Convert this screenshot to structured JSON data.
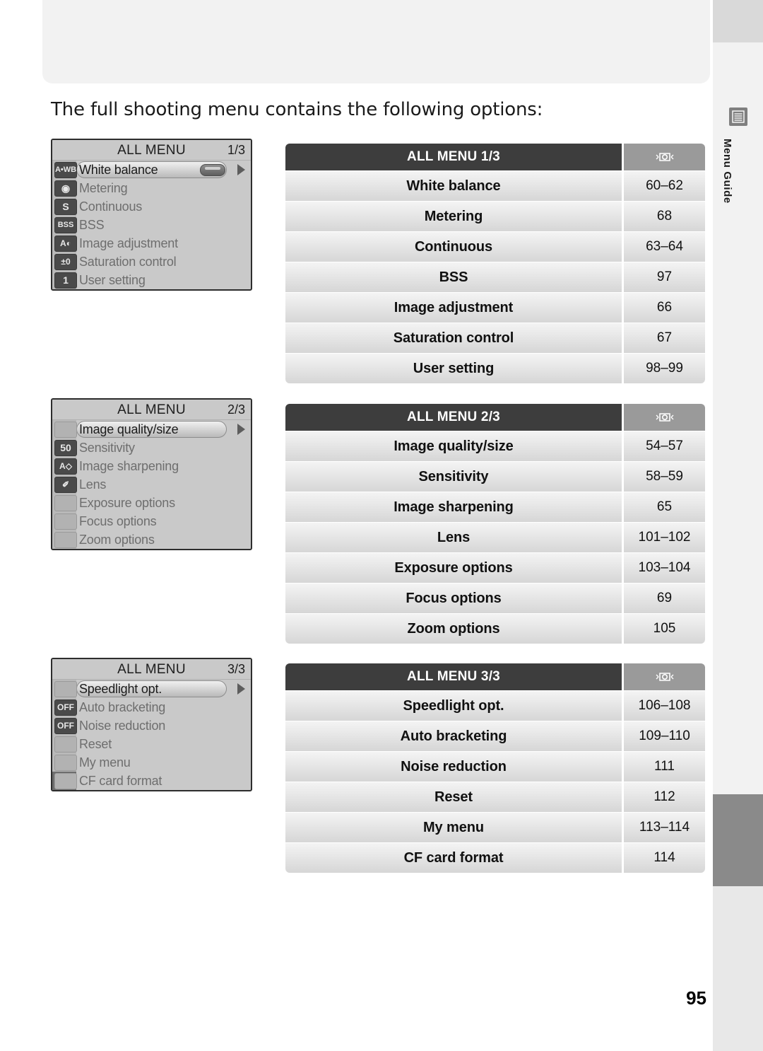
{
  "page": {
    "intro": "The full shooting menu contains the following options:",
    "number": "95",
    "rail_label": "Menu Guide",
    "rail_icon": "menu-icon"
  },
  "lcd_screens": [
    {
      "title": "ALL MENU",
      "page": "1/3",
      "rows": [
        {
          "icon": "A•WB",
          "icon_style": "dark",
          "label": "White balance",
          "selected": true,
          "arrow": true,
          "pill": true
        },
        {
          "icon": "◉",
          "icon_style": "dark",
          "label": "Metering",
          "selected": false
        },
        {
          "icon": "S",
          "icon_style": "dark",
          "label": "Continuous",
          "selected": false
        },
        {
          "icon": "BSS",
          "icon_style": "dark",
          "label": "BSS",
          "selected": false
        },
        {
          "icon": "A◐",
          "icon_style": "dark",
          "label": "Image adjustment",
          "selected": false
        },
        {
          "icon": "±0",
          "icon_style": "dark",
          "label": "Saturation control",
          "selected": false
        },
        {
          "icon": "1",
          "icon_style": "dark",
          "label": "User setting",
          "selected": false
        }
      ]
    },
    {
      "title": "ALL MENU",
      "page": "2/3",
      "rows": [
        {
          "icon": "",
          "icon_style": "blank",
          "label": "Image quality/size",
          "selected": true,
          "arrow": true
        },
        {
          "icon": "50",
          "icon_style": "dark",
          "label": "Sensitivity",
          "selected": false
        },
        {
          "icon": "A◇",
          "icon_style": "dark",
          "label": "Image sharpening",
          "selected": false
        },
        {
          "icon": "✐",
          "icon_style": "dark",
          "label": "Lens",
          "selected": false
        },
        {
          "icon": "",
          "icon_style": "blank",
          "label": "Exposure options",
          "selected": false
        },
        {
          "icon": "",
          "icon_style": "blank",
          "label": "Focus options",
          "selected": false
        },
        {
          "icon": "",
          "icon_style": "blank",
          "label": "Zoom options",
          "selected": false
        }
      ]
    },
    {
      "title": "ALL MENU",
      "page": "3/3",
      "rows": [
        {
          "icon": "",
          "icon_style": "blank",
          "label": "Speedlight opt.",
          "selected": true,
          "arrow": true
        },
        {
          "icon": "OFF",
          "icon_style": "dark",
          "label": "Auto bracketing",
          "selected": false
        },
        {
          "icon": "OFF",
          "icon_style": "dark",
          "label": "Noise reduction",
          "selected": false
        },
        {
          "icon": "",
          "icon_style": "blank",
          "label": "Reset",
          "selected": false
        },
        {
          "icon": "",
          "icon_style": "blank",
          "label": "My menu",
          "selected": false
        },
        {
          "icon": "",
          "icon_style": "blank",
          "label": "CF card format",
          "selected": false
        }
      ]
    }
  ],
  "tables": [
    {
      "header": "ALL MENU 1/3",
      "header_icon": "camera-mode-icon",
      "rows": [
        {
          "label": "White balance",
          "pages": "60–62"
        },
        {
          "label": "Metering",
          "pages": "68"
        },
        {
          "label": "Continuous",
          "pages": "63–64"
        },
        {
          "label": "BSS",
          "pages": "97"
        },
        {
          "label": "Image adjustment",
          "pages": "66"
        },
        {
          "label": "Saturation control",
          "pages": "67"
        },
        {
          "label": "User setting",
          "pages": "98–99"
        }
      ]
    },
    {
      "header": "ALL MENU 2/3",
      "header_icon": "camera-mode-icon",
      "rows": [
        {
          "label": "Image quality/size",
          "pages": "54–57"
        },
        {
          "label": "Sensitivity",
          "pages": "58–59"
        },
        {
          "label": "Image sharpening",
          "pages": "65"
        },
        {
          "label": "Lens",
          "pages": "101–102"
        },
        {
          "label": "Exposure options",
          "pages": "103–104"
        },
        {
          "label": "Focus options",
          "pages": "69"
        },
        {
          "label": "Zoom options",
          "pages": "105"
        }
      ]
    },
    {
      "header": "ALL MENU 3/3",
      "header_icon": "camera-mode-icon",
      "rows": [
        {
          "label": "Speedlight opt.",
          "pages": "106–108"
        },
        {
          "label": "Auto bracketing",
          "pages": "109–110"
        },
        {
          "label": "Noise reduction",
          "pages": "111"
        },
        {
          "label": "Reset",
          "pages": "112"
        },
        {
          "label": "My menu",
          "pages": "113–114"
        },
        {
          "label": "CF card format",
          "pages": "114"
        }
      ]
    }
  ]
}
